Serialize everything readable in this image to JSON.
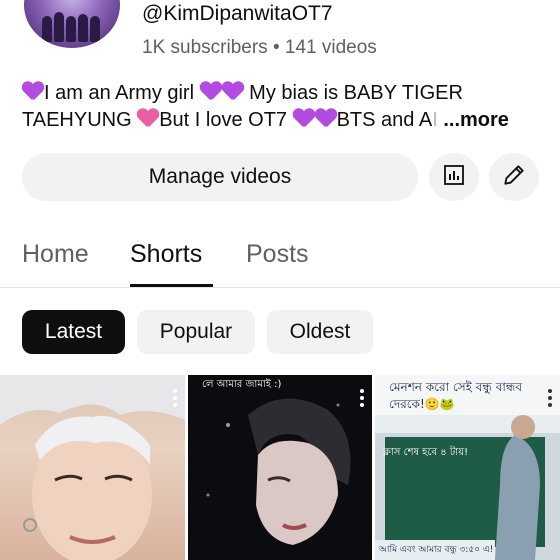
{
  "channel": {
    "handle": "@KimDipanwitaOT7",
    "meta": "1K subscribers • 141 videos",
    "bio": {
      "line1_a": "I am an Army girl ",
      "line1_b": " My bias is BABY TIGER",
      "line2_a": "TAEHYUNG ",
      "line2_b": "But I love OT7 ",
      "line2_c": "BTS and A",
      "more": "...more"
    }
  },
  "actions": {
    "manage_label": "Manage videos",
    "analytics_icon": "bar-chart-icon",
    "edit_icon": "pencil-icon"
  },
  "tabs": [
    {
      "label": "Home",
      "active": false
    },
    {
      "label": "Shorts",
      "active": true
    },
    {
      "label": "Posts",
      "active": false
    }
  ],
  "filters": [
    {
      "label": "Latest",
      "active": true
    },
    {
      "label": "Popular",
      "active": false
    },
    {
      "label": "Oldest",
      "active": false
    }
  ],
  "shorts": [
    {
      "caption": ""
    },
    {
      "caption": "লে আমার জামাই :)"
    },
    {
      "caption_top": "মেনশন করো সেই বন্ধু বান্ধব দেরকে!🙂🐸",
      "caption_mid": "ক্লাস শেষ হবে ৪ টায়!",
      "caption_bottom": "আমি এবং আমার বন্ধু ৩:৫০ এ!"
    }
  ],
  "colors": {
    "heart_purple": "#b44be0",
    "heart_pink": "#ea5ea6",
    "chip_active": "#0f0f0f",
    "button_bg": "#f2f2f2"
  }
}
